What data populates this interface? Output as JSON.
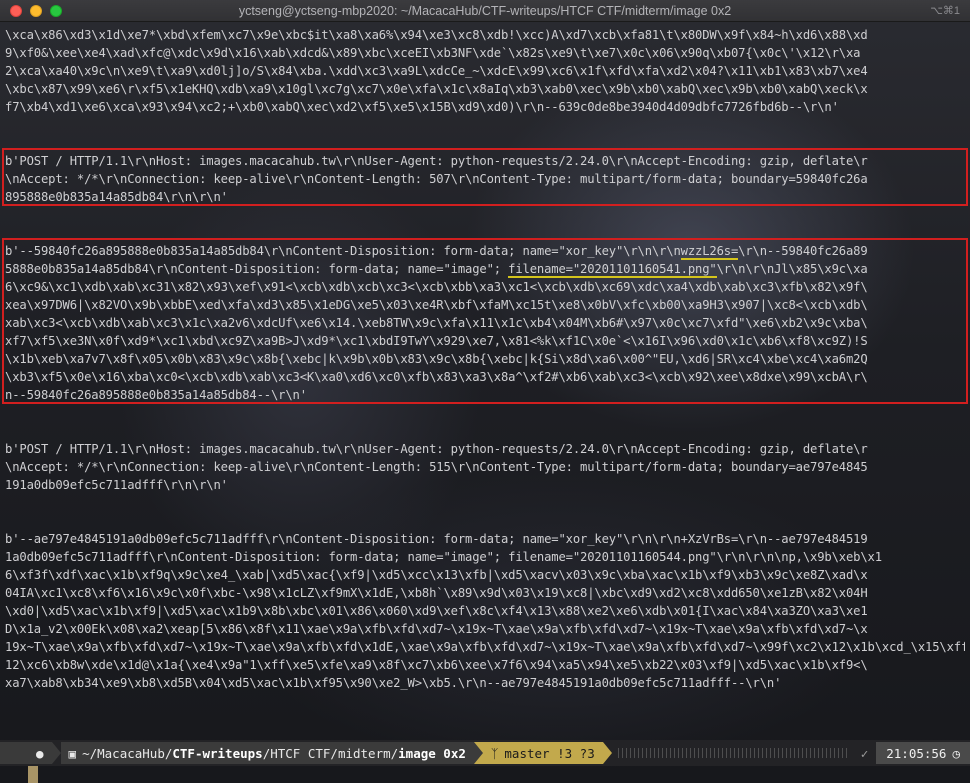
{
  "window": {
    "title": "yctseng@yctseng-mbp2020: ~/MacacaHub/CTF-writeups/HTCF CTF/midterm/image 0x2",
    "shortcut": "⌥⌘1"
  },
  "terminal": {
    "lines": [
      "\\xca\\x86\\xd3\\x1d\\xe7*\\xbd\\xfem\\xc7\\x9e\\xbc$it\\xa8\\xa6%\\x94\\xe3\\xc8\\xdb!\\xcc)A\\xd7\\xcb\\xfa81\\t\\x80DW\\x9f\\x84~h\\xd6\\x88\\xd",
      "9\\xf0&\\xee\\xe4\\xad\\xfc@\\xdc\\x9d\\x16\\xab\\xdcd&\\x89\\xbc\\xceEI\\xb3NF\\xde`\\x82s\\xe9\\t\\xe7\\x0c\\x06\\x90q\\xb07{\\x0c\\'\\x12\\r\\xa",
      "2\\xca\\xa40\\x9c\\n\\xe9\\t\\xa9\\xd0lj]o/S\\x84\\xba.\\xdd\\xc3\\xa9L\\xdcCe_~\\xdcE\\x99\\xc6\\x1f\\xfd\\xfa\\xd2\\x04?\\x11\\xb1\\x83\\xb7\\xe4",
      "\\xbc\\x87\\x99\\xe6\\r\\xf5\\x1eKHQ\\xdb\\xa9\\x10gl\\xc7g\\xc7\\x0e\\xfa\\x1c\\x8aIq\\xb3\\xab0\\xec\\x9b\\xb0\\xabQ\\xec\\x9b\\xb0\\xabQ\\xeck\\x",
      "f7\\xb4\\xd1\\xe6\\xca\\x93\\x94\\xc2;+\\xb0\\xabQ\\xec\\xd2\\xf5\\xe5\\x15B\\xd9\\xd0)\\r\\n--639c0de8be3940d4d09dbfc7726fbd6b--\\r\\n'",
      "",
      "",
      "b'POST / HTTP/1.1\\r\\nHost: images.macacahub.tw\\r\\nUser-Agent: python-requests/2.24.0\\r\\nAccept-Encoding: gzip, deflate\\r",
      "\\nAccept: */*\\r\\nConnection: keep-alive\\r\\nContent-Length: 507\\r\\nContent-Type: multipart/form-data; boundary=59840fc26a",
      "895888e0b835a14a85db84\\r\\n\\r\\n'",
      "",
      "",
      "b'--59840fc26a895888e0b835a14a85db84\\r\\nContent-Disposition: form-data; name=\"xor_key\"\\r\\n\\r\\nwzzL26s=\\r\\n--59840fc26a89",
      "5888e0b835a14a85db84\\r\\nContent-Disposition: form-data; name=\"image\"; filename=\"20201101160541.png\"\\r\\n\\r\\nJl\\x85\\x9c\\xa",
      "6\\xc9&\\xc1\\xdb\\xab\\xc31\\x82\\x93\\xef\\x91<\\xcb\\xdb\\xcb\\xc3<\\xcb\\xbb\\xa3\\xc1<\\xcb\\xdb\\xc69\\xdc\\xa4\\xdb\\xab\\xc3\\xfb\\x82\\x9f\\",
      "xea\\x97DW6|\\x82VO\\x9b\\xbbE\\xed\\xfa\\xd3\\x85\\x1eDG\\xe5\\x03\\xe4R\\xbf\\xfaM\\xc15t\\xe8\\x0bV\\xfc\\xb00\\xa9H3\\x907|\\xc8<\\xcb\\xdb\\",
      "xab\\xc3<\\xcb\\xdb\\xab\\xc3\\x1c\\xa2v6\\xdcUf\\xe6\\x14.\\xeb8TW\\x9c\\xfa\\x11\\x1c\\xb4\\x04M\\xb6#\\x97\\x0c\\xc7\\xfd\"\\xe6\\xb2\\x9c\\xba\\",
      "xf7\\xf5\\xe3N\\x0f\\xd9*\\xc1\\xbd\\xc9Z\\xa9B>J\\xd9*\\xc1\\xbdI9TwY\\x929\\xe7,\\x81<%k\\xf1C\\x0e`<\\x16I\\x96\\xd0\\x1c\\xb6\\xf8\\xc9Z)!S",
      "\\x1b\\xeb\\xa7v7\\x8f\\x05\\x0b\\x83\\x9c\\x8b{\\xebc|k\\x9b\\x0b\\x83\\x9c\\x8b{\\xebc|k{Si\\x8d\\xa6\\x00^\"EU,\\xd6|SR\\xc4\\xbe\\xc4\\xa6m2Q",
      "\\xb3\\xf5\\x0e\\x16\\xba\\xc0<\\xcb\\xdb\\xab\\xc3<K\\xa0\\xd6\\xc0\\xfb\\x83\\xa3\\x8a^\\xf2#\\xb6\\xab\\xc3<\\xcb\\x92\\xee\\x8dxe\\x99\\xcbA\\r\\",
      "n--59840fc26a895888e0b835a14a85db84--\\r\\n'",
      "",
      "",
      "b'POST / HTTP/1.1\\r\\nHost: images.macacahub.tw\\r\\nUser-Agent: python-requests/2.24.0\\r\\nAccept-Encoding: gzip, deflate\\r",
      "\\nAccept: */*\\r\\nConnection: keep-alive\\r\\nContent-Length: 515\\r\\nContent-Type: multipart/form-data; boundary=ae797e4845",
      "191a0db09efc5c711adfff\\r\\n\\r\\n'",
      "",
      "",
      "b'--ae797e4845191a0db09efc5c711adfff\\r\\nContent-Disposition: form-data; name=\"xor_key\"\\r\\n\\r\\n+XzVrBs=\\r\\n--ae797e484519",
      "1a0db09efc5c711adfff\\r\\nContent-Disposition: form-data; name=\"image\"; filename=\"20201101160544.png\"\\r\\n\\r\\n\\np,\\x9b\\xeb\\x1",
      "6\\xf3f\\xdf\\xac\\x1b\\xf9q\\x9c\\xe4_\\xab|\\xd5\\xac{\\xf9|\\xd5\\xcc\\x13\\xfb|\\xd5\\xacv\\x03\\x9c\\xba\\xac\\x1b\\xf9\\xb3\\x9c\\xe8Z\\xad\\x",
      "04IA\\xc1\\xc8\\xf6\\x16\\x9c\\x0f\\xbc-\\x98\\x1cLZ\\xf9mX\\x1dE,\\xb8h`\\x89\\x9d\\x03\\x19\\xc8|\\xbc\\xd9\\xd2\\xc8\\xdd650\\xe1zB\\x82\\x04H",
      "\\xd0|\\xd5\\xac\\x1b\\xf9|\\xd5\\xac\\x1b9\\x8b\\xbc\\x01\\x86\\x060\\xd9\\xef\\x8c\\xf4\\x13\\x88\\xe2\\xe6\\xdb\\x01{I\\xac\\x84\\xa3ZO\\xa3\\xe1",
      "D\\x1a_v2\\x00Ek\\x08\\xa2\\xeap[5\\x86\\x8f\\x11\\xae\\x9a\\xfb\\xfd\\xd7~\\x19x~T\\xae\\x9a\\xfb\\xfd\\xd7~\\x19x~T\\xae\\x9a\\xfb\\xfd\\xd7~\\x",
      "19x~T\\xae\\x9a\\xfb\\xfd\\xd7~\\x19x~T\\xae\\x9a\\xfb\\xfd\\x1dE,\\xae\\x9a\\xfb\\xfd\\xd7~\\x19x~T\\xae\\x9a\\xfb\\xfd\\xd7~\\x99f\\xc2\\x12\\x1b\\xcd_\\x15\\xff\\t\\xb7\\x",
      "12\\xc6\\xb8w\\xde\\x1d@\\x1a{\\xe4\\x9a\"1\\xff\\xe5\\xfe\\xa9\\x8f\\xc7\\xb6\\xee\\x7f6\\x94\\xa5\\x94\\xe5\\xb22\\x03\\xf9|\\xd5\\xac\\x1b\\xf9<\\",
      "xa7\\xab8\\xb34\\xe9\\xb8\\xd5B\\x04\\xd5\\xac\\x1b\\xf95\\x90\\xe2_W>\\xb5.\\r\\n--ae797e4845191a0db09efc5c711adfff--\\r\\n'"
    ]
  },
  "status": {
    "path_prefix": "~/MacacaHub/",
    "path_bold_1": "CTF-writeups",
    "path_mid": "/HTCF CTF/midterm/",
    "path_bold_2": "image 0x2",
    "git_icon": "git-branch-icon",
    "git_status": "master !3 ?3",
    "check": "✓",
    "time": "21:05:56",
    "clock_icon": "clock-icon",
    "os_icon": "apple-icon",
    "folder_icon": "folder-icon"
  },
  "colors": {
    "highlight_border": "#d21f1f",
    "underline": "#d4c41c",
    "git_segment": "#c2a94c"
  }
}
